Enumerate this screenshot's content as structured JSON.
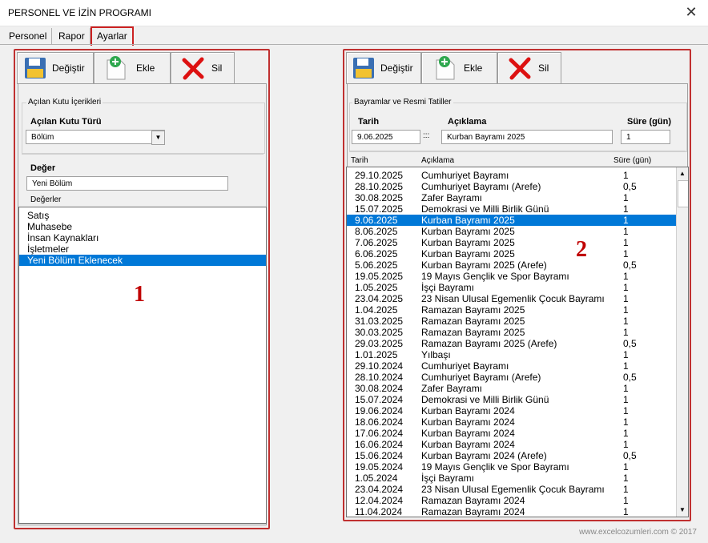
{
  "window": {
    "title": "PERSONEL VE İZİN PROGRAMI"
  },
  "tabs": [
    {
      "label": "Personel"
    },
    {
      "label": "Rapor"
    },
    {
      "label": "Ayarlar"
    }
  ],
  "left": {
    "toolbar": {
      "change": "Değiştir",
      "add": "Ekle",
      "delete": "Sil"
    },
    "group_title": "Açılan Kutu İçerikleri",
    "type_label": "Açılan Kutu Türü",
    "type_value": "Bölüm",
    "value_label": "Değer",
    "value_input": "Yeni Bölüm",
    "values_label": "Değerler",
    "values": [
      "Satış",
      "Muhasebe",
      "İnsan Kaynakları",
      "İşletmeler",
      "Yeni Bölüm Eklenecek"
    ],
    "selected_index": 4,
    "marker": "1"
  },
  "right": {
    "toolbar": {
      "change": "Değiştir",
      "add": "Ekle",
      "delete": "Sil"
    },
    "group_title": "Bayramlar ve Resmi Tatiller",
    "date_label": "Tarih",
    "desc_label": "Açıklama",
    "dur_label": "Süre (gün)",
    "date_value": "9.06.2025",
    "sep": ":::",
    "desc_value": "Kurban Bayramı 2025",
    "dur_value": "1",
    "col_date": "Tarih",
    "col_desc": "Açıklama",
    "col_dur": "Süre (gün)",
    "marker": "2",
    "selected_index": 4,
    "rows": [
      [
        "29.10.2025",
        "Cumhuriyet Bayramı",
        "1"
      ],
      [
        "28.10.2025",
        "Cumhuriyet Bayramı (Arefe)",
        "0,5"
      ],
      [
        "30.08.2025",
        "Zafer Bayramı",
        "1"
      ],
      [
        "15.07.2025",
        "Demokrasi ve Milli Birlik Günü",
        "1"
      ],
      [
        "9.06.2025",
        "Kurban Bayramı 2025",
        "1"
      ],
      [
        "8.06.2025",
        "Kurban Bayramı 2025",
        "1"
      ],
      [
        "7.06.2025",
        "Kurban Bayramı 2025",
        "1"
      ],
      [
        "6.06.2025",
        "Kurban Bayramı 2025",
        "1"
      ],
      [
        "5.06.2025",
        "Kurban Bayramı 2025 (Arefe)",
        "0,5"
      ],
      [
        "19.05.2025",
        "19 Mayıs Gençlik ve Spor Bayramı",
        "1"
      ],
      [
        "1.05.2025",
        "İşçi Bayramı",
        "1"
      ],
      [
        "23.04.2025",
        "23 Nisan Ulusal Egemenlik Çocuk Bayramı",
        "1"
      ],
      [
        "1.04.2025",
        "Ramazan Bayramı 2025",
        "1"
      ],
      [
        "31.03.2025",
        "Ramazan Bayramı 2025",
        "1"
      ],
      [
        "30.03.2025",
        "Ramazan Bayramı 2025",
        "1"
      ],
      [
        "29.03.2025",
        "Ramazan Bayramı 2025 (Arefe)",
        "0,5"
      ],
      [
        "1.01.2025",
        "Yılbaşı",
        "1"
      ],
      [
        "29.10.2024",
        "Cumhuriyet Bayramı",
        "1"
      ],
      [
        "28.10.2024",
        "Cumhuriyet Bayramı (Arefe)",
        "0,5"
      ],
      [
        "30.08.2024",
        "Zafer Bayramı",
        "1"
      ],
      [
        "15.07.2024",
        "Demokrasi ve Milli Birlik Günü",
        "1"
      ],
      [
        "19.06.2024",
        "Kurban Bayramı 2024",
        "1"
      ],
      [
        "18.06.2024",
        "Kurban Bayramı 2024",
        "1"
      ],
      [
        "17.06.2024",
        "Kurban Bayramı 2024",
        "1"
      ],
      [
        "16.06.2024",
        "Kurban Bayramı 2024",
        "1"
      ],
      [
        "15.06.2024",
        "Kurban Bayramı 2024 (Arefe)",
        "0,5"
      ],
      [
        "19.05.2024",
        "19 Mayıs Gençlik ve Spor Bayramı",
        "1"
      ],
      [
        "1.05.2024",
        "İşçi Bayramı",
        "1"
      ],
      [
        "23.04.2024",
        "23 Nisan Ulusal Egemenlik Çocuk Bayramı",
        "1"
      ],
      [
        "12.04.2024",
        "Ramazan Bayramı 2024",
        "1"
      ],
      [
        "11.04.2024",
        "Ramazan Bayramı 2024",
        "1"
      ]
    ]
  },
  "footer": "www.excelcozumleri.com © 2017",
  "colors": {
    "highlight": "#0078d7",
    "frame": "#c03030",
    "marker": "#c00000"
  },
  "icons": [
    "save-icon",
    "add-document-icon",
    "delete-x-icon",
    "close-icon",
    "scroll-up-icon",
    "scroll-down-icon",
    "dropdown-arrow-icon"
  ]
}
